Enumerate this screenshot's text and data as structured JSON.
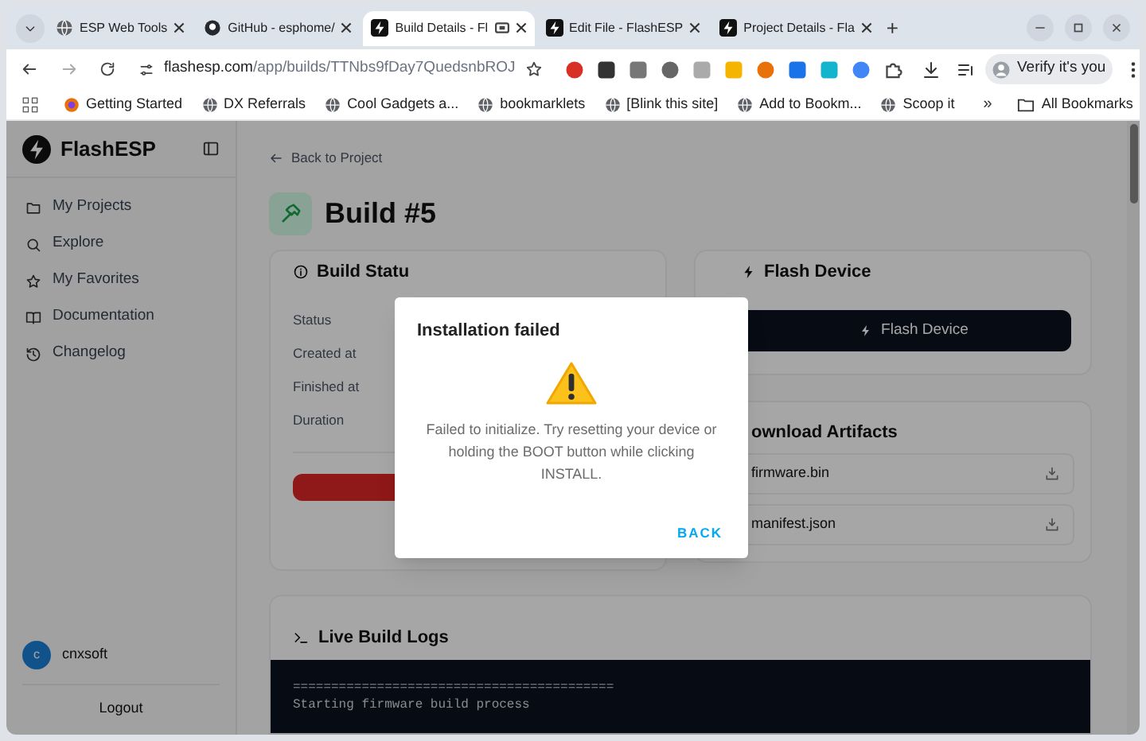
{
  "browser": {
    "tabs": [
      {
        "title": "ESP Web Tools",
        "selected": false
      },
      {
        "title": "GitHub - esphome/",
        "selected": false
      },
      {
        "title": "Build Details - Fl",
        "selected": true
      },
      {
        "title": "Edit File - FlashESP",
        "selected": false
      },
      {
        "title": "Project Details - Fla",
        "selected": false
      }
    ],
    "new_tab": "+",
    "url_host": "flashesp.com",
    "url_path": "/app/builds/TTNbs9fDay7QuedsnbROJ",
    "profile_button": "Verify it's you",
    "bookmarks": [
      "Getting Started",
      "DX Referrals",
      "Cool Gadgets a...",
      "bookmarklets",
      "[Blink this site]",
      "Add to Bookm...",
      "Scoop it"
    ],
    "bookmarks_more": "»",
    "all_bookmarks": "All Bookmarks"
  },
  "app": {
    "brand": "FlashESP",
    "nav": [
      "My Projects",
      "Explore",
      "My Favorites",
      "Documentation",
      "Changelog"
    ],
    "user": {
      "initial": "c",
      "name": "cnxsoft"
    },
    "logout": "Logout",
    "back_link": "Back to Project",
    "title": "Build #5",
    "status_card": {
      "title": "Build Statu",
      "rows": [
        "Status",
        "Created at",
        "Finished at",
        "Duration"
      ]
    },
    "flash_card": {
      "title": "Flash Device",
      "button": "Flash Device"
    },
    "artifacts_card": {
      "title": "ownload Artifacts",
      "files": [
        "firmware.bin",
        "manifest.json"
      ]
    },
    "logs_card": {
      "title": "Live Build Logs",
      "lines": [
        "==========================================",
        "Starting firmware build process"
      ]
    }
  },
  "dialog": {
    "title": "Installation failed",
    "message": "Failed to initialize. Try resetting your device or holding the BOOT button while clicking INSTALL.",
    "action": "BACK"
  }
}
